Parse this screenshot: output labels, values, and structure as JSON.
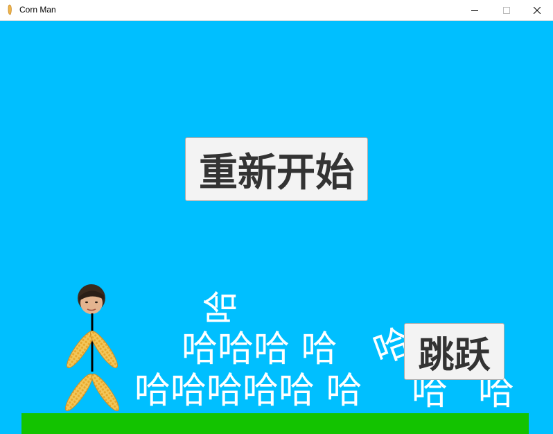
{
  "window": {
    "title": "Corn Man"
  },
  "game": {
    "restart_label": "重新开始",
    "jump_label": "跳跃",
    "floating_texts": {
      "row0": "哈",
      "row1a": "哈哈哈 哈",
      "row1b": "哈",
      "row2a": "哈哈哈哈哈 哈",
      "row2b": "哈",
      "row2c": "哈"
    }
  },
  "colors": {
    "sky": "#00bfff",
    "ground": "#13c300",
    "text": "#ffffff"
  },
  "icons": [
    "corn-icon",
    "minimize-icon",
    "maximize-icon",
    "close-icon"
  ]
}
